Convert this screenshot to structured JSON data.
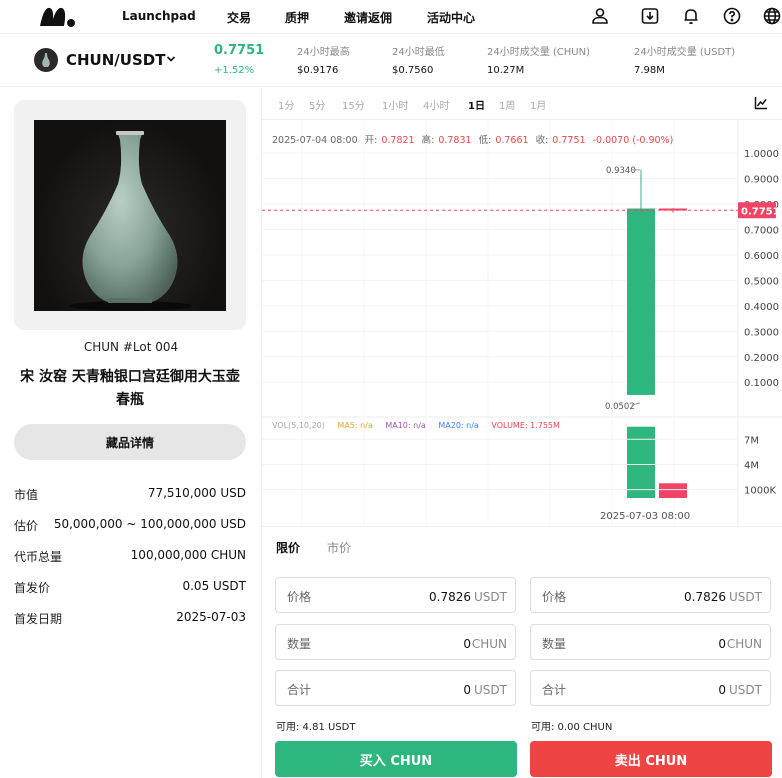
{
  "nav": {
    "items": [
      "Launchpad",
      "交易",
      "质押",
      "邀请返佣",
      "活动中心"
    ],
    "icons": [
      "user-icon",
      "download-icon",
      "bell-icon",
      "help-icon",
      "globe-icon"
    ]
  },
  "ticker": {
    "pair": "CHUN/USDT",
    "last_price": "0.7751",
    "change": "+1.52%",
    "stats": [
      {
        "label": "24小时最高",
        "value": "$0.9176"
      },
      {
        "label": "24小时最低",
        "value": "$0.7560"
      },
      {
        "label": "24小时成交量 (CHUN)",
        "value": "10.27M"
      },
      {
        "label": "24小时成交量 (USDT)",
        "value": "7.98M"
      }
    ]
  },
  "item": {
    "lot": "CHUN #Lot 004",
    "title": "宋 汝窑 天青釉银口宫廷御用大玉壶春瓶",
    "details_button": "藏品详情",
    "info": [
      {
        "key": "市值",
        "value": "77,510,000 USD"
      },
      {
        "key": "估价",
        "value": "50,000,000 ~ 100,000,000 USD"
      },
      {
        "key": "代币总量",
        "value": "100,000,000 CHUN"
      },
      {
        "key": "首发价",
        "value": "0.05 USDT"
      },
      {
        "key": "首发日期",
        "value": "2025-07-03"
      }
    ]
  },
  "timeframes": [
    "1分",
    "5分",
    "15分",
    "1小时",
    "4小时",
    "1日",
    "1周",
    "1月"
  ],
  "active_timeframe": "1日",
  "ohlc": {
    "date": "2025-07-04 08:00",
    "open_label": "开:",
    "open": "0.7821",
    "high_label": "高:",
    "high": "0.7831",
    "low_label": "低:",
    "low": "0.7661",
    "close_label": "收:",
    "close": "0.7751",
    "change": "-0.0070 (-0.90%)"
  },
  "volume_legend": {
    "vol": "VOL(5,10,20)",
    "ma5": "MA5: n/a",
    "ma10": "MA10: n/a",
    "ma20": "MA20: n/a",
    "volume": "VOLUME: 1.755M"
  },
  "chart_data": {
    "type": "candlestick",
    "price_axis": [
      "1.0000",
      "0.9000",
      "0.8000",
      "0.7000",
      "0.6000",
      "0.5000",
      "0.4000",
      "0.3000",
      "0.2000",
      "0.1000"
    ],
    "price_range": [
      0.0,
      1.05
    ],
    "current_price": "0.7751",
    "candles": [
      {
        "date": "2025-07-03",
        "open": 0.0502,
        "high": 0.934,
        "low": 0.0502,
        "close": 0.7821,
        "direction": "up"
      },
      {
        "date": "2025-07-04",
        "open": 0.7821,
        "high": 0.7831,
        "low": 0.7661,
        "close": 0.7751,
        "direction": "down"
      }
    ],
    "high_marker": "0.9340",
    "low_marker": "0.0502",
    "volume_axis": [
      "7M",
      "4M",
      "1000K"
    ],
    "volume_range": [
      0,
      9.3
    ],
    "volumes": [
      {
        "value": 8.5,
        "direction": "up"
      },
      {
        "value": 1.755,
        "direction": "down"
      }
    ],
    "x_label": "2025-07-03 08:00",
    "colors": {
      "up": "#2db67d",
      "down": "#ef4466"
    }
  },
  "order": {
    "tabs": [
      "限价",
      "市价"
    ],
    "buy": {
      "fields": [
        {
          "label": "价格",
          "value": "0.7826",
          "unit": "USDT"
        },
        {
          "label": "数量",
          "value": "0",
          "unit": "CHUN"
        },
        {
          "label": "合计",
          "value": "0",
          "unit": "USDT"
        }
      ],
      "available": "可用: 4.81 USDT",
      "button": "买入 CHUN"
    },
    "sell": {
      "fields": [
        {
          "label": "价格",
          "value": "0.7826",
          "unit": "USDT"
        },
        {
          "label": "数量",
          "value": "0",
          "unit": "CHUN"
        },
        {
          "label": "合计",
          "value": "0",
          "unit": "USDT"
        }
      ],
      "available": "可用: 0.00 CHUN",
      "button": "卖出 CHUN"
    }
  }
}
